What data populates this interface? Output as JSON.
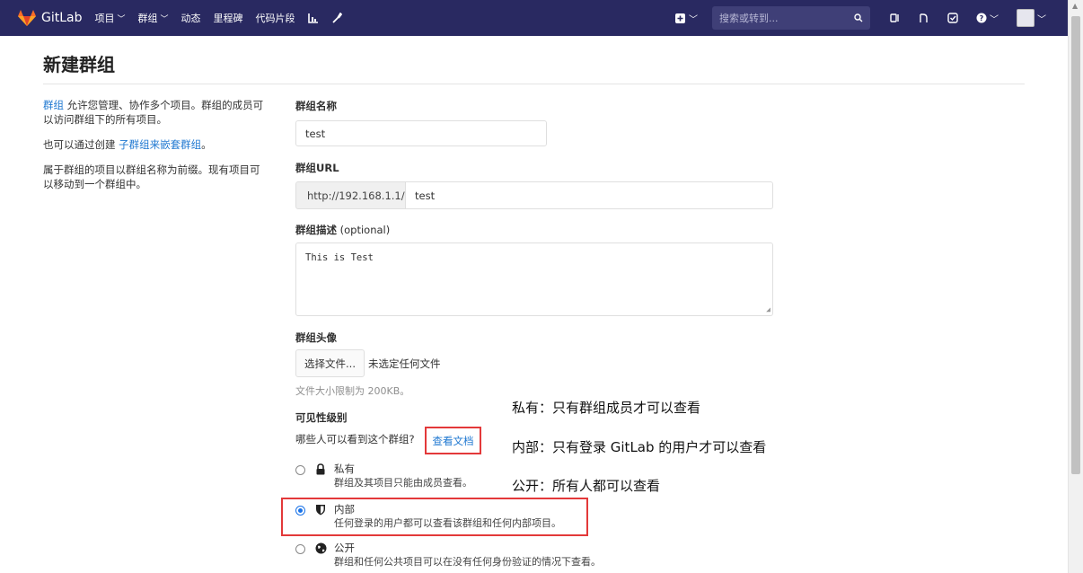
{
  "navbar": {
    "brand": "GitLab",
    "items": [
      {
        "label": "项目",
        "has_caret": true
      },
      {
        "label": "群组",
        "has_caret": true
      },
      {
        "label": "动态"
      },
      {
        "label": "里程碑"
      },
      {
        "label": "代码片段"
      }
    ],
    "icons": [
      "chart-icon",
      "wrench-icon"
    ],
    "search_placeholder": "搜索或转到...",
    "caret": "⌵"
  },
  "page": {
    "title": "新建群组"
  },
  "sidebar": {
    "p1_link": "群组",
    "p1_text": " 允许您管理、协作多个项目。群组的成员可以访问群组下的所有项目。",
    "p2_text": "也可以通过创建 ",
    "p2_link": "子群组来嵌套群组",
    "p2_end": "。",
    "p3_text": "属于群组的项目以群组名称为前缀。现有项目可以移动到一个群组中。"
  },
  "form": {
    "name_label": "群组名称",
    "name_value": "test",
    "url_label": "群组URL",
    "url_prefix": "http://192.168.1.1/",
    "url_value": "test",
    "desc_label": "群组描述",
    "desc_optional": " (optional)",
    "desc_value": "This is Test",
    "avatar_label": "群组头像",
    "file_button": "选择文件...",
    "file_none": "未选定任何文件",
    "file_hint": "文件大小限制为 200KB。",
    "visibility_label": "可见性级别",
    "visibility_question": "哪些人可以看到这个群组?",
    "docs_link": "查看文档",
    "visibility_options": [
      {
        "title": "私有",
        "desc": "群组及其项目只能由成员查看。",
        "icon": "lock-icon",
        "checked": false
      },
      {
        "title": "内部",
        "desc": "任何登录的用户都可以查看该群组和任何内部项目。",
        "icon": "shield-icon",
        "checked": true
      },
      {
        "title": "公开",
        "desc": "群组和任何公共项目可以在没有任何身份验证的情况下查看。",
        "icon": "globe-icon",
        "checked": false
      }
    ]
  },
  "annotations": {
    "private": "私有：只有群组成员才可以查看",
    "internal": "内部：只有登录 GitLab 的用户才可以查看",
    "public": "公开：所有人都可以查看"
  },
  "colors": {
    "navbar": "#292961",
    "link": "#1f78d1",
    "highlight": "#e3393a"
  }
}
